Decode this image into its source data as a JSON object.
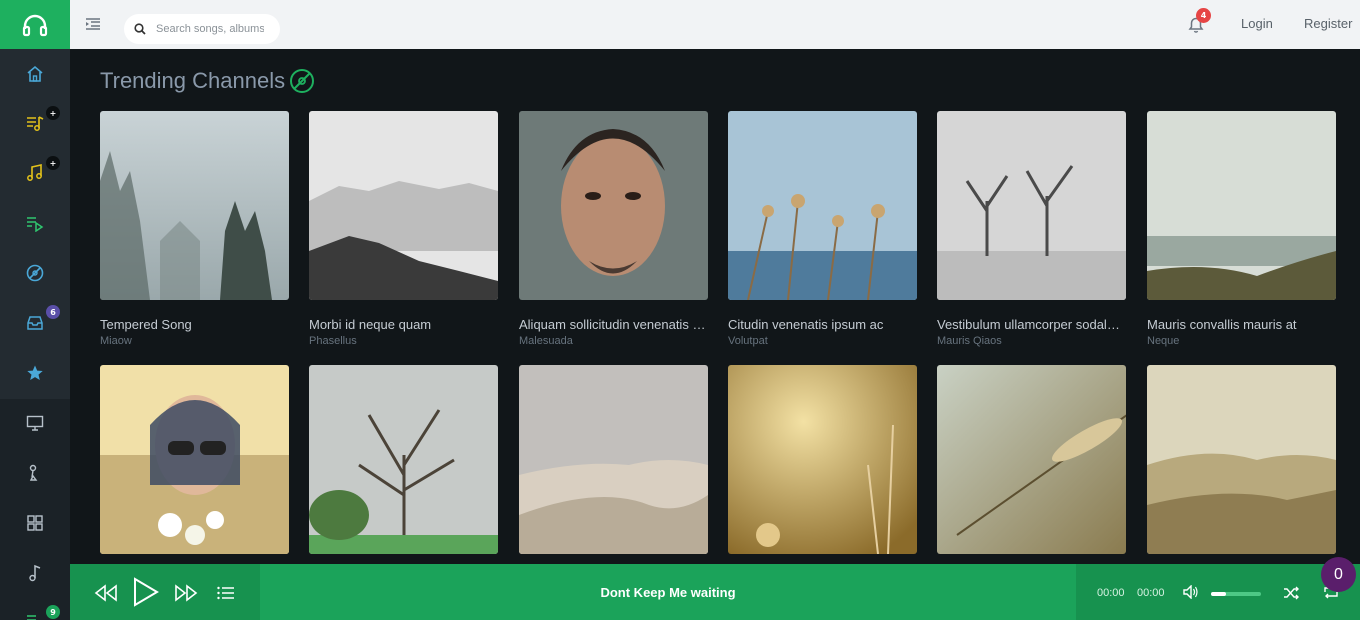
{
  "search": {
    "placeholder": "Search songs, albums..."
  },
  "header": {
    "notification_count": "4",
    "login_label": "Login",
    "register_label": "Register"
  },
  "sidebar": {
    "items": [
      {
        "icon": "home-icon"
      },
      {
        "icon": "playlist-add-icon",
        "badge": "+"
      },
      {
        "icon": "music-note-add-icon",
        "badge": "+"
      },
      {
        "icon": "playlist-play-icon"
      },
      {
        "icon": "disc-icon"
      },
      {
        "icon": "inbox-icon",
        "badge": "6"
      },
      {
        "icon": "star-icon"
      },
      {
        "icon": "monitor-icon"
      },
      {
        "icon": "microphone-icon"
      },
      {
        "icon": "grid-icon"
      },
      {
        "icon": "music-note-icon"
      },
      {
        "icon": "playlist-icon",
        "badge": "9"
      }
    ]
  },
  "section": {
    "title": "Trending Channels",
    "icon": "disc-icon"
  },
  "cards": [
    {
      "title": "Tempered Song",
      "subtitle": "Miaow"
    },
    {
      "title": "Morbi id neque quam",
      "subtitle": "Phasellus"
    },
    {
      "title": "Aliquam sollicitudin venenatis ipsum",
      "subtitle": "Malesuada"
    },
    {
      "title": "Citudin venenatis ipsum ac",
      "subtitle": "Volutpat"
    },
    {
      "title": "Vestibulum ullamcorper sodales nisi",
      "subtitle": "Mauris Qiaos"
    },
    {
      "title": "Mauris convallis mauris at",
      "subtitle": "Neque"
    },
    {
      "title": "",
      "subtitle": ""
    },
    {
      "title": "",
      "subtitle": ""
    },
    {
      "title": "",
      "subtitle": ""
    },
    {
      "title": "",
      "subtitle": ""
    },
    {
      "title": "",
      "subtitle": ""
    },
    {
      "title": "",
      "subtitle": ""
    }
  ],
  "player": {
    "track_title": "Dont Keep Me waiting",
    "current_time": "00:00",
    "total_time": "00:00",
    "volume": 0.3,
    "queue_count": "0"
  },
  "colors": {
    "brand_green": "#1eb05f",
    "player_green": "#1ba35a",
    "badge_red": "#e64545",
    "badge_purple": "#5a4fa8",
    "queue_purple": "#5a1e6b"
  }
}
